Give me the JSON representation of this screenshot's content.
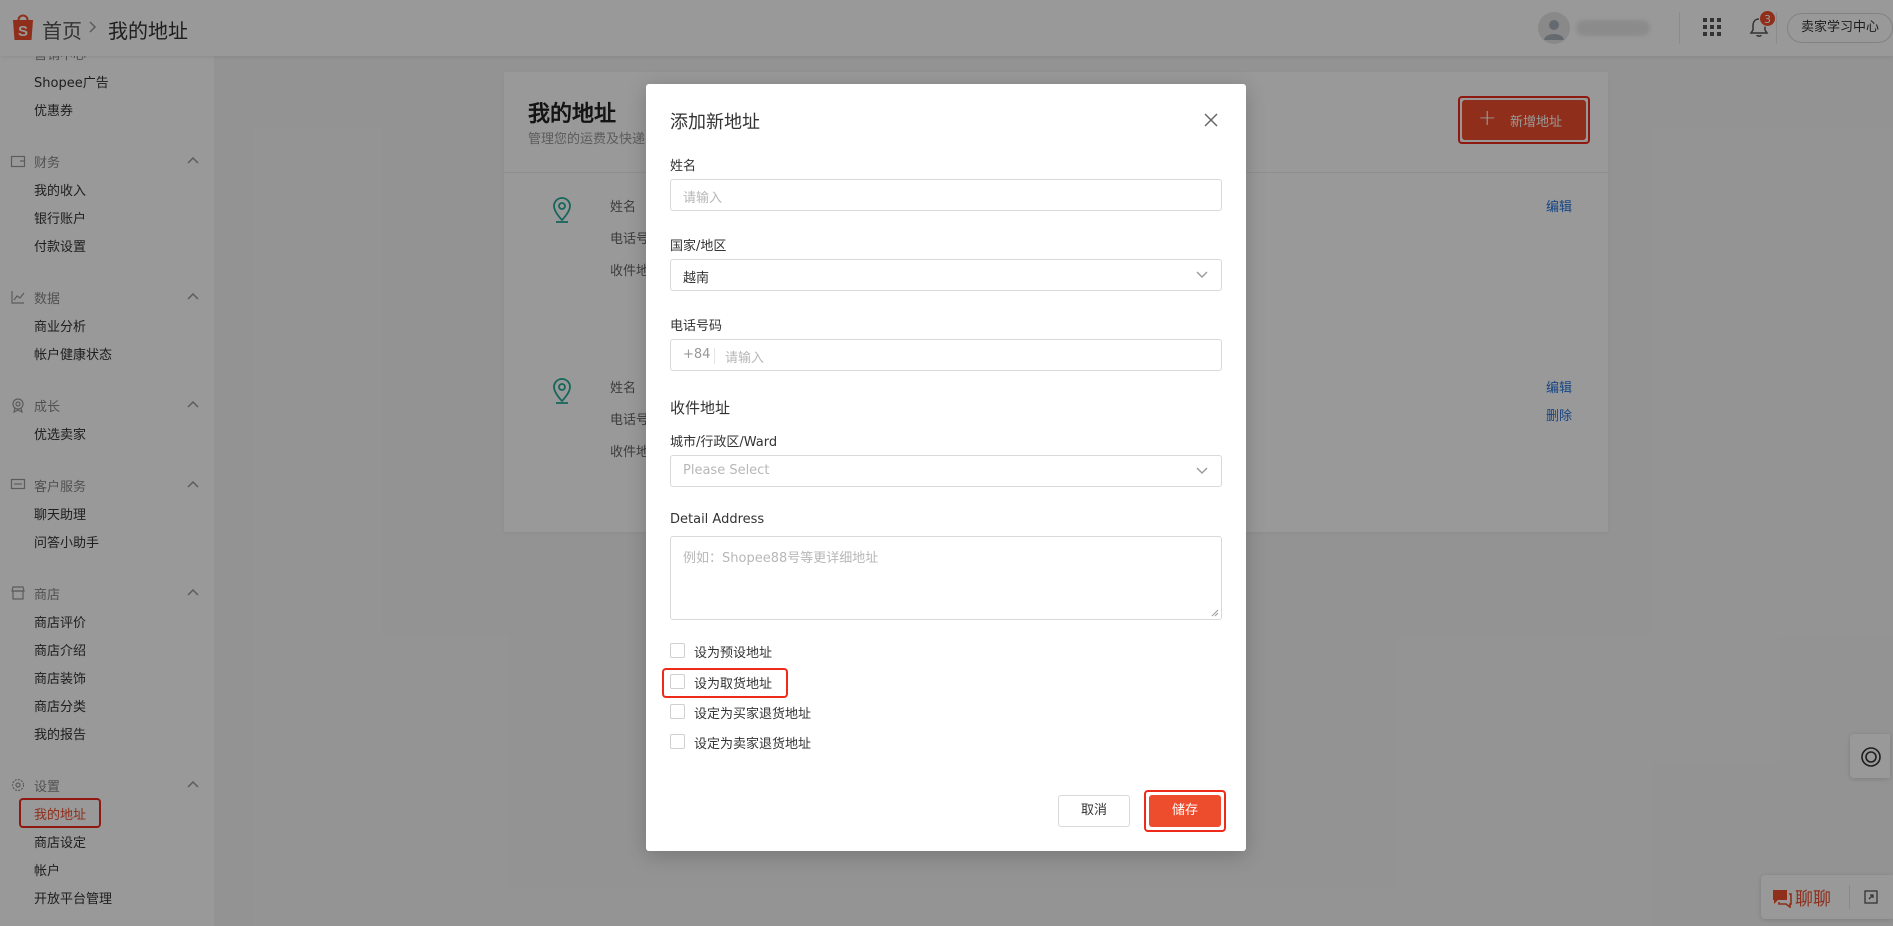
{
  "header": {
    "breadcrumb_home": "首页",
    "breadcrumb_current": "我的地址",
    "notification_count": "3",
    "learn_center": "卖家学习中心"
  },
  "sidebar": {
    "items_top": [
      "Shopee广告",
      "优惠券"
    ],
    "groups": [
      {
        "title": "财务",
        "icon": "wallet-icon",
        "items": [
          "我的收入",
          "银行账户",
          "付款设置"
        ]
      },
      {
        "title": "数据",
        "icon": "chart-icon",
        "items": [
          "商业分析",
          "帐户健康状态"
        ]
      },
      {
        "title": "成长",
        "icon": "medal-icon",
        "items": [
          "优选卖家"
        ]
      },
      {
        "title": "客户服务",
        "icon": "chat-bubble-icon",
        "items": [
          "聊天助理",
          "问答小助手"
        ]
      },
      {
        "title": "商店",
        "icon": "store-icon",
        "items": [
          "商店评价",
          "商店介绍",
          "商店装饰",
          "商店分类",
          "我的报告"
        ]
      },
      {
        "title": "设置",
        "icon": "gear-icon",
        "items": [
          "我的地址",
          "商店设定",
          "帐户",
          "开放平台管理"
        ]
      }
    ]
  },
  "page": {
    "title": "我的地址",
    "subtitle": "管理您的运费及快递",
    "add_button": "新增地址",
    "address_labels": [
      "姓名",
      "电话号",
      "收件地"
    ],
    "edit": "编辑",
    "delete": "删除"
  },
  "modal": {
    "title": "添加新地址",
    "name_label": "姓名",
    "name_placeholder": "请输入",
    "country_label": "国家/地区",
    "country_value": "越南",
    "phone_label": "电话号码",
    "phone_prefix": "+84",
    "phone_placeholder": "请输入",
    "address_section": "收件地址",
    "city_label": "城市/行政区/Ward",
    "city_placeholder": "Please Select",
    "detail_label": "Detail Address",
    "detail_placeholder": "例如：Shopee88号等更详细地址",
    "checkboxes": [
      "设为预设地址",
      "设为取货地址",
      "设定为买家退货地址",
      "设定为卖家退货地址"
    ],
    "cancel": "取消",
    "save": "储存"
  },
  "chat": {
    "label": "聊聊"
  },
  "colors": {
    "brand": "#ee4d2d",
    "highlight": "#ee2a1b",
    "link": "#2673dd",
    "pin": "#26aa99"
  }
}
